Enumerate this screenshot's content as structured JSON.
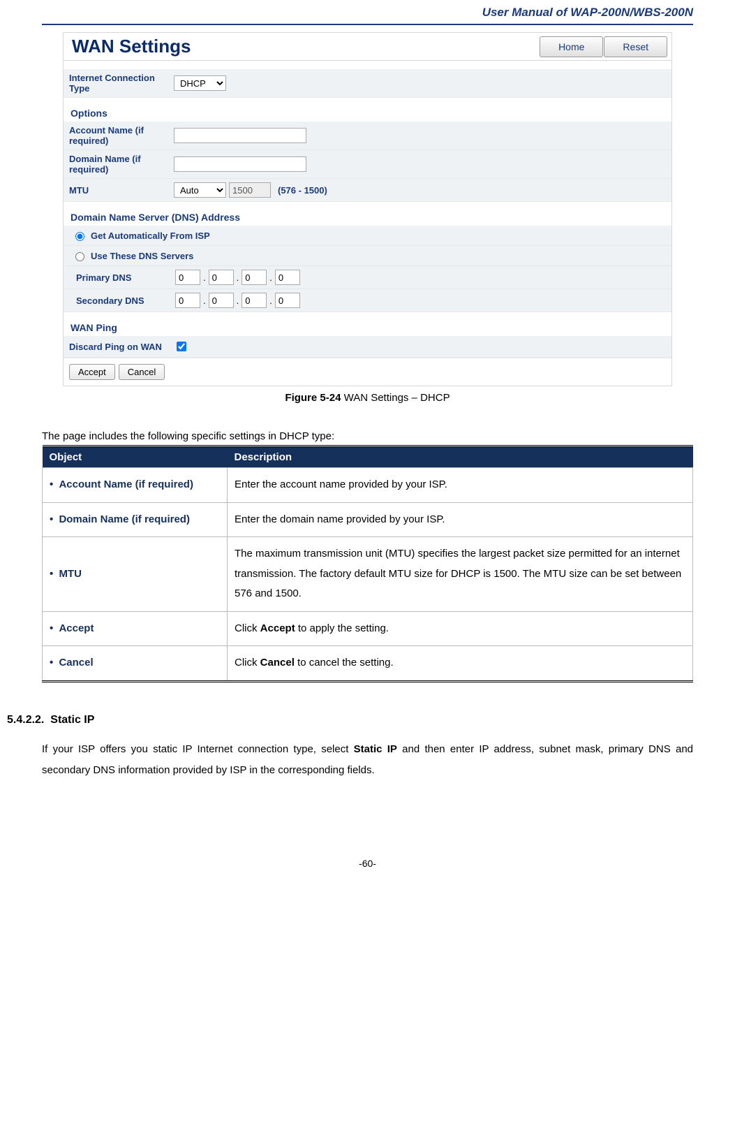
{
  "header": {
    "doc_title": "User Manual of WAP-200N/WBS-200N"
  },
  "screenshot": {
    "title": "WAN Settings",
    "home_btn": "Home",
    "reset_btn": "Reset",
    "conn_type_label": "Internet Connection Type",
    "conn_type_value": "DHCP",
    "options_label": "Options",
    "account_label": "Account Name (if required)",
    "account_value": "",
    "domain_label": "Domain Name (if required)",
    "domain_value": "",
    "mtu_label": "MTU",
    "mtu_mode": "Auto",
    "mtu_value": "1500",
    "mtu_range": "(576 - 1500)",
    "dns_section": "Domain Name Server (DNS) Address",
    "dns_opt1": "Get Automatically From ISP",
    "dns_opt2": "Use These DNS Servers",
    "primary_dns_label": "Primary DNS",
    "secondary_dns_label": "Secondary DNS",
    "dns_oct": "0",
    "wan_ping_section": "WAN Ping",
    "discard_label": "Discard Ping on WAN",
    "accept_btn": "Accept",
    "cancel_btn": "Cancel"
  },
  "figure": {
    "number": "Figure 5-24",
    "caption": " WAN Settings – DHCP"
  },
  "intro": "The page includes the following specific settings in DHCP type:",
  "table": {
    "head_obj": "Object",
    "head_desc": "Description",
    "rows": [
      {
        "obj": "Account Name (if required)",
        "desc": "Enter the account name provided by your ISP."
      },
      {
        "obj": "Domain Name (if required)",
        "desc": "Enter the domain name provided by your ISP."
      },
      {
        "obj": "MTU",
        "desc": "The maximum transmission unit (MTU) specifies the largest packet size permitted for an internet transmission. The factory default MTU size for DHCP is 1500. The MTU size can be set between 576 and 1500."
      },
      {
        "obj": "Accept",
        "desc_pre": "Click ",
        "desc_bold": "Accept",
        "desc_post": " to apply the setting."
      },
      {
        "obj": "Cancel",
        "desc_pre": "Click ",
        "desc_bold": "Cancel",
        "desc_post": " to cancel the setting."
      }
    ]
  },
  "section": {
    "number": "5.4.2.2.",
    "title": "Static IP",
    "body_pre": "If your ISP offers you static IP Internet connection type, select ",
    "body_bold": "Static IP",
    "body_post": " and then enter IP address, subnet mask, primary DNS and secondary DNS information provided by ISP in the corresponding fields."
  },
  "footer": {
    "page": "-60-"
  }
}
